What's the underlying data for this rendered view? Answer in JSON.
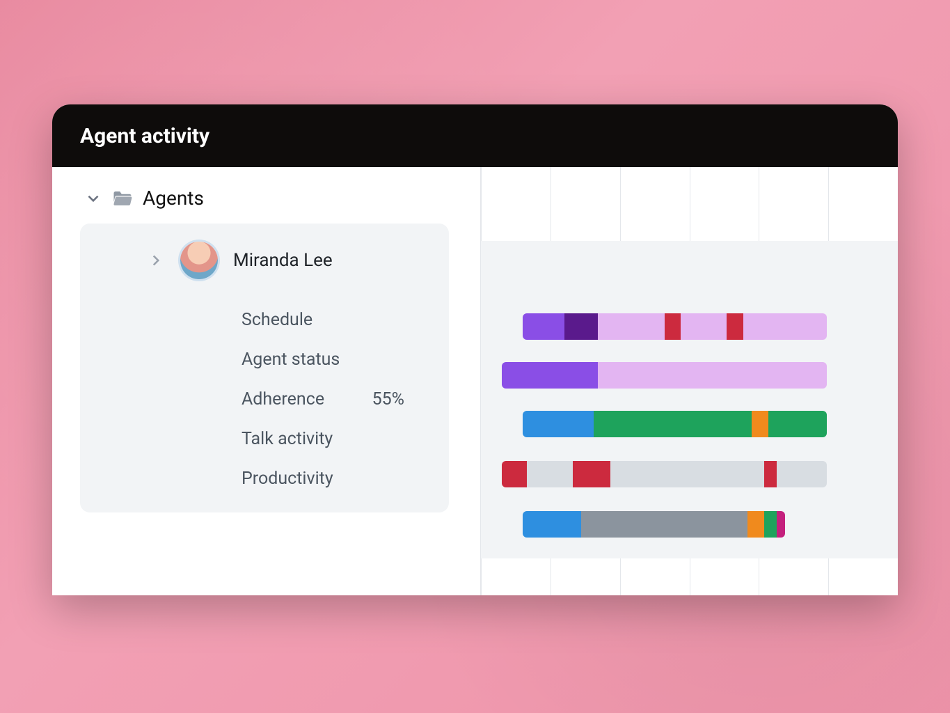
{
  "header": {
    "title": "Agent activity"
  },
  "group": {
    "label": "Agents"
  },
  "agent": {
    "name": "Miranda Lee",
    "metrics": {
      "schedule": {
        "label": "Schedule"
      },
      "agent_status": {
        "label": "Agent status"
      },
      "adherence": {
        "label": "Adherence",
        "value": "55%"
      },
      "talk_activity": {
        "label": "Talk activity"
      },
      "productivity": {
        "label": "Productivity"
      }
    }
  },
  "colors": {
    "purple": "#8a4ee6",
    "darkpurple": "#5a1a8c",
    "lilac": "#e3b5f2",
    "red": "#cc2a3e",
    "blue": "#2e8fe0",
    "green": "#1ea35c",
    "orange": "#f08a1d",
    "silver": "#d8dde2",
    "gray": "#8b949e",
    "magenta": "#c4207d"
  },
  "chart_data": {
    "type": "bar",
    "note": "Horizontal stacked timeline bars per metric. Percentages are estimated horizontal extents of each colored segment relative to one full grid column ≈ 16.5% of visible track width. Only visible (un-cropped) portion shown; right edge is truncated by the card border.",
    "grid_columns_visible": 6,
    "rows": [
      {
        "name": "Schedule",
        "left_offset_pct": 10,
        "segments": [
          {
            "color": "purple",
            "width_pct": 10
          },
          {
            "color": "darkpurple",
            "width_pct": 8
          },
          {
            "color": "lilac",
            "width_pct": 16
          },
          {
            "color": "red",
            "width_pct": 4
          },
          {
            "color": "lilac",
            "width_pct": 11
          },
          {
            "color": "red",
            "width_pct": 4
          },
          {
            "color": "lilac",
            "width_pct": 20
          }
        ]
      },
      {
        "name": "Agent status",
        "left_offset_pct": 5,
        "segments": [
          {
            "color": "purple",
            "width_pct": 23
          },
          {
            "color": "lilac",
            "width_pct": 55
          }
        ]
      },
      {
        "name": "Adherence",
        "left_offset_pct": 10,
        "segments": [
          {
            "color": "blue",
            "width_pct": 17
          },
          {
            "color": "green",
            "width_pct": 38
          },
          {
            "color": "orange",
            "width_pct": 4
          },
          {
            "color": "green",
            "width_pct": 14
          }
        ]
      },
      {
        "name": "Talk activity",
        "left_offset_pct": 5,
        "segments": [
          {
            "color": "red",
            "width_pct": 6
          },
          {
            "color": "silver",
            "width_pct": 11
          },
          {
            "color": "red",
            "width_pct": 9
          },
          {
            "color": "silver",
            "width_pct": 37
          },
          {
            "color": "red",
            "width_pct": 3
          },
          {
            "color": "silver",
            "width_pct": 12
          }
        ]
      },
      {
        "name": "Productivity",
        "left_offset_pct": 10,
        "segments": [
          {
            "color": "blue",
            "width_pct": 14
          },
          {
            "color": "gray",
            "width_pct": 40
          },
          {
            "color": "orange",
            "width_pct": 4
          },
          {
            "color": "green",
            "width_pct": 3
          },
          {
            "color": "magenta",
            "width_pct": 2
          }
        ]
      }
    ]
  }
}
